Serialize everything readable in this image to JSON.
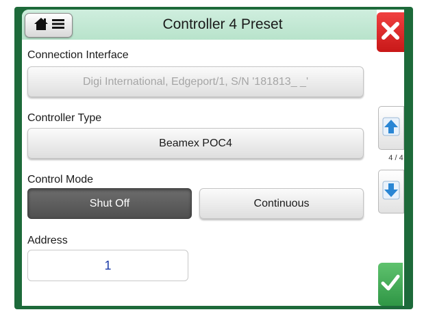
{
  "header": {
    "title": "Controller 4 Preset",
    "home_icon": "home-icon",
    "menu_icon": "menu-icon"
  },
  "connection_interface": {
    "label": "Connection Interface",
    "value": "Digi International,  Edgeport/1,  S/N '181813_ _'"
  },
  "controller_type": {
    "label": "Controller Type",
    "value": "Beamex POC4"
  },
  "control_mode": {
    "label": "Control Mode",
    "options": [
      "Shut Off",
      "Continuous"
    ],
    "selected": "Shut Off"
  },
  "address": {
    "label": "Address",
    "value": "1"
  },
  "side": {
    "close_icon": "close-icon",
    "page_up_icon": "arrow-up-icon",
    "page_indicator": "4 / 4",
    "page_down_icon": "arrow-down-icon",
    "accept_icon": "checkmark-icon"
  },
  "colors": {
    "frame": "#1d6a3a",
    "titlebar": "#c4e8d3",
    "close": "#e02a2a",
    "accept": "#3aa853",
    "nav_arrow": "#2a86d4",
    "address_text": "#1a3aa8"
  }
}
